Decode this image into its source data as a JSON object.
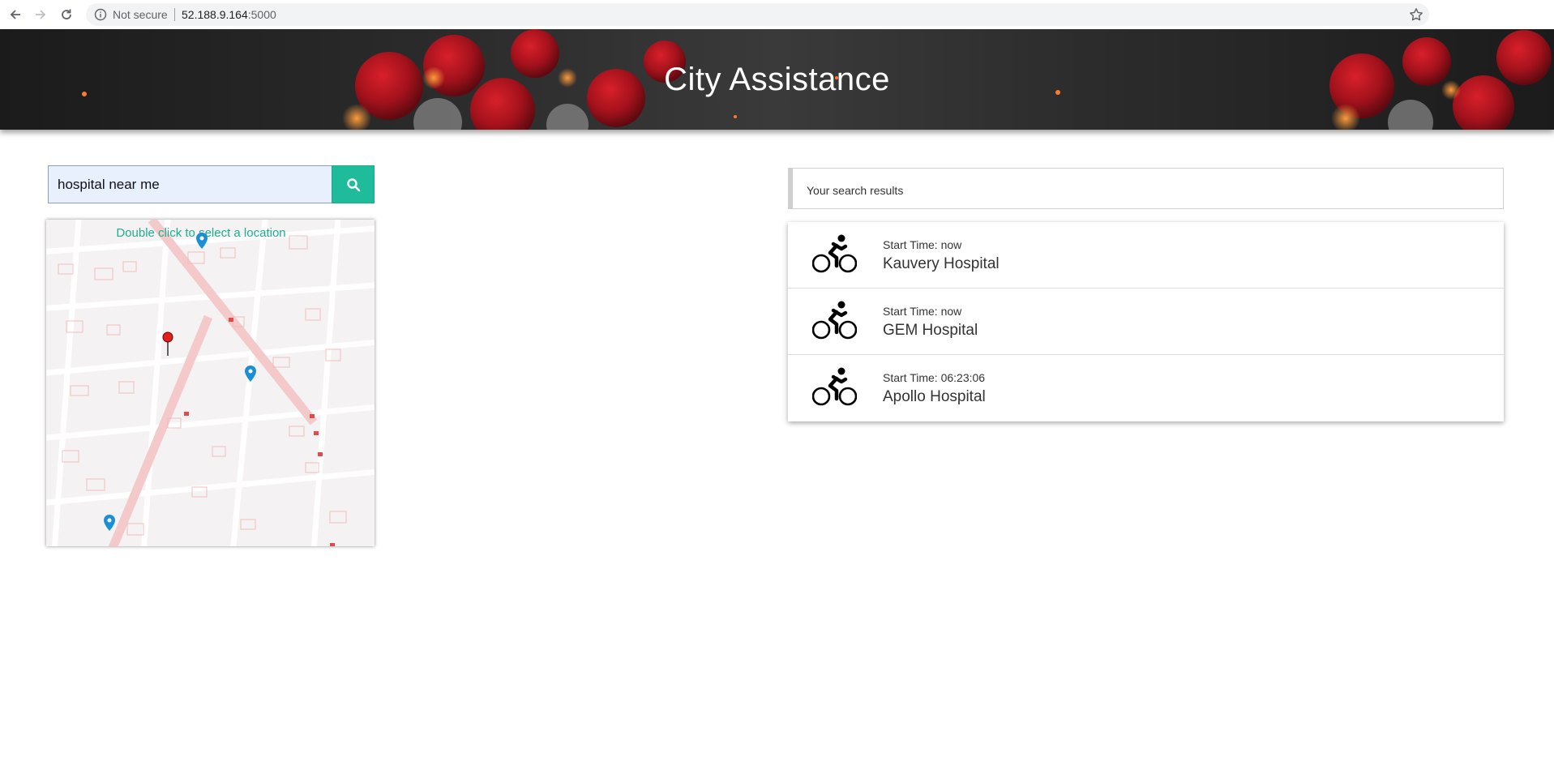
{
  "browser": {
    "security_label": "Not secure",
    "url_host": "52.188.9.164",
    "url_port": ":5000",
    "icons": [
      "back-arrow-icon",
      "forward-arrow-icon",
      "reload-icon",
      "info-icon",
      "star-icon"
    ]
  },
  "header": {
    "title": "City Assistance"
  },
  "search": {
    "value": "hospital near me",
    "button_icon": "search-icon"
  },
  "map": {
    "hint": "Double click to select a location",
    "marker_colors": {
      "selected": "#e02020",
      "result": "#1a8fd8"
    }
  },
  "results": {
    "header": "Your search results",
    "items": [
      {
        "time": "Start Time: now",
        "name": "Kauvery Hospital",
        "icon": "bicycle-icon"
      },
      {
        "time": "Start Time: now",
        "name": "GEM Hospital",
        "icon": "bicycle-icon"
      },
      {
        "time": "Start Time: 06:23:06",
        "name": "Apollo Hospital",
        "icon": "bicycle-icon"
      }
    ]
  },
  "colors": {
    "accent": "#1fbc9c",
    "input_bg": "#e8f0fe"
  }
}
